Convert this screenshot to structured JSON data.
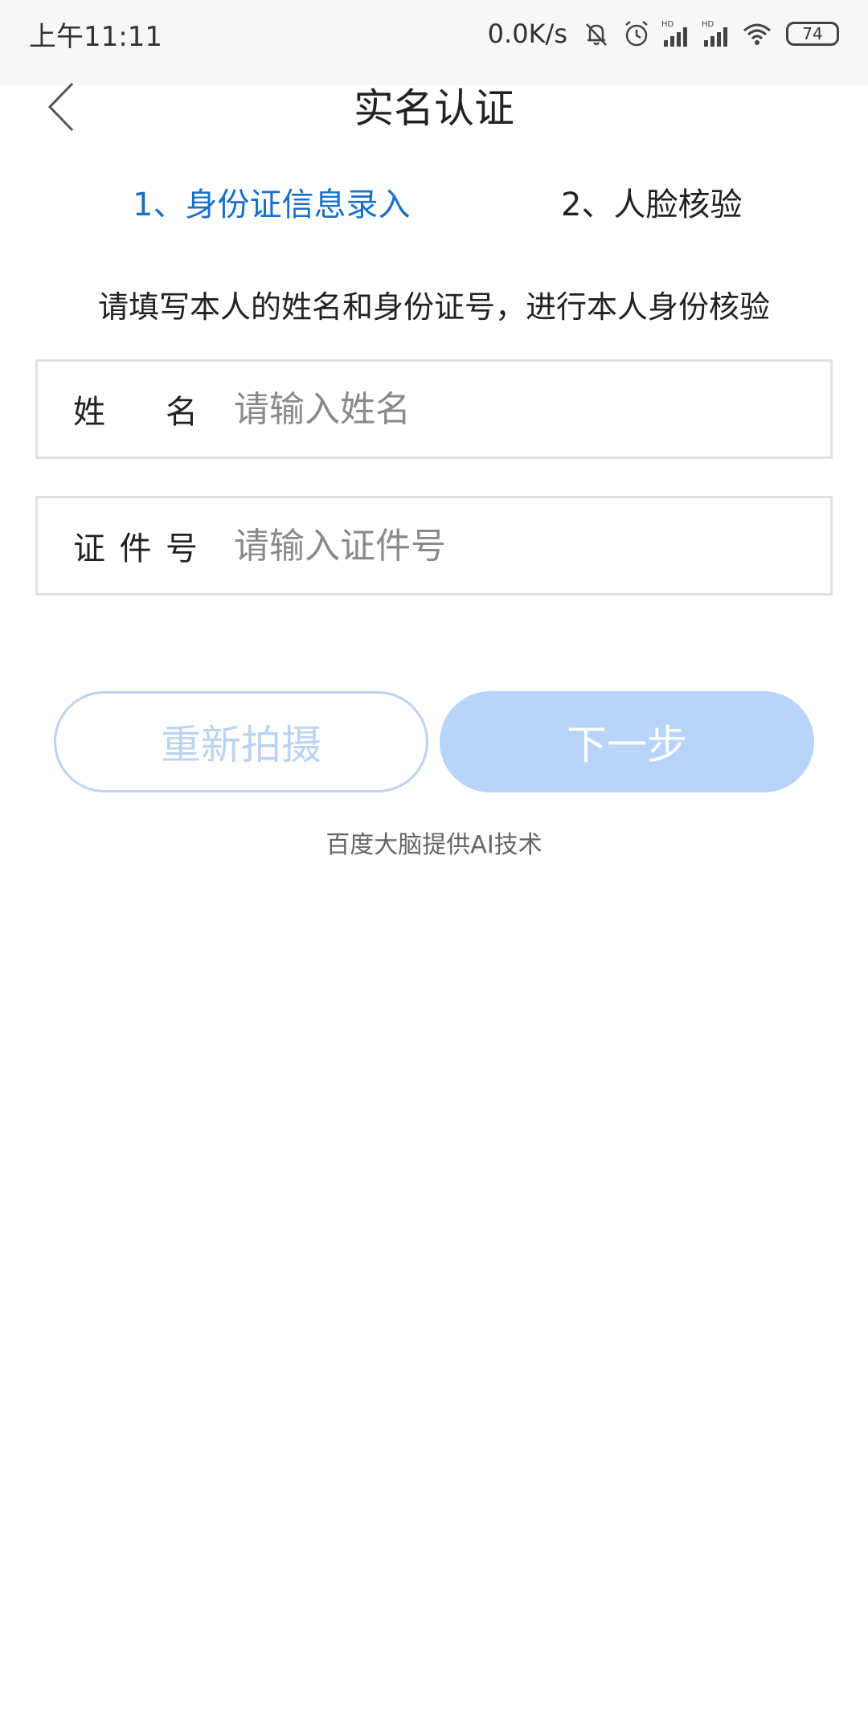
{
  "status_bar": {
    "time": "上午11:11",
    "network_speed": "0.0K/s",
    "battery_level": "74",
    "icons": [
      "bell-muted-icon",
      "alarm-icon",
      "signal-hd-icon",
      "signal-hd-icon",
      "wifi-icon",
      "battery-icon"
    ]
  },
  "header": {
    "title": "实名认证",
    "back_icon": "chevron-left-icon"
  },
  "steps": [
    {
      "label": "1、身份证信息录入",
      "active": true
    },
    {
      "label": "2、人脸核验",
      "active": false
    }
  ],
  "instruction": "请填写本人的姓名和身份证号，进行本人身份核验",
  "form": {
    "name": {
      "label_chars": [
        "姓",
        "名"
      ],
      "value": "",
      "placeholder": "请输入姓名"
    },
    "id_number": {
      "label_chars": [
        "证",
        "件",
        "号"
      ],
      "value": "",
      "placeholder": "请输入证件号"
    }
  },
  "buttons": {
    "retake": "重新拍摄",
    "next": "下一步"
  },
  "credit": "百度大脑提供AI技术",
  "colors": {
    "active_step": "#1a6fc9",
    "next_button_bg": "#b9d4fb",
    "retake_border": "#bcd3ef"
  }
}
